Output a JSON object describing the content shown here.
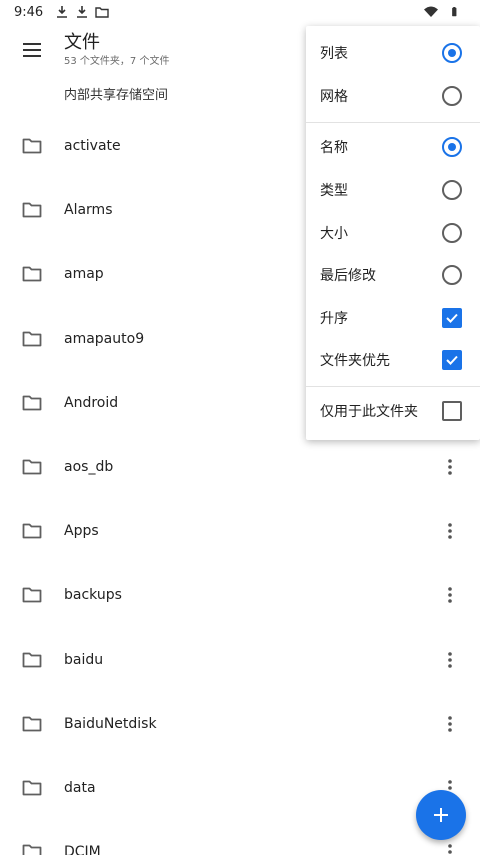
{
  "status_bar": {
    "time": "9:46",
    "icons": [
      "download-icon",
      "download-icon",
      "folder-icon",
      "wifi-icon",
      "battery-icon"
    ]
  },
  "app_bar": {
    "title": "文件",
    "subtitle": "53 个文件夹，7 个文件",
    "menu_icon": "hamburger-menu-icon"
  },
  "breadcrumb": "内部共享存储空间",
  "files": [
    {
      "name": "activate"
    },
    {
      "name": "Alarms"
    },
    {
      "name": "amap"
    },
    {
      "name": "amapauto9"
    },
    {
      "name": "Android"
    },
    {
      "name": "aos_db"
    },
    {
      "name": "Apps"
    },
    {
      "name": "backups"
    },
    {
      "name": "baidu"
    },
    {
      "name": "BaiduNetdisk"
    },
    {
      "name": "data"
    },
    {
      "name": "DCIM"
    }
  ],
  "view_menu": {
    "view_modes": [
      {
        "label": "列表",
        "selected": true
      },
      {
        "label": "网格",
        "selected": false
      }
    ],
    "sort_by": [
      {
        "label": "名称",
        "selected": true
      },
      {
        "label": "类型",
        "selected": false
      },
      {
        "label": "大小",
        "selected": false
      },
      {
        "label": "最后修改",
        "selected": false
      }
    ],
    "options": [
      {
        "label": "升序",
        "checked": true
      },
      {
        "label": "文件夹优先",
        "checked": true
      }
    ],
    "scope": {
      "label": "仅用于此文件夹",
      "checked": false
    }
  },
  "colors": {
    "accent": "#1a73e8",
    "icon_gray": "#5f5f5f"
  },
  "fab_icon": "plus-icon"
}
